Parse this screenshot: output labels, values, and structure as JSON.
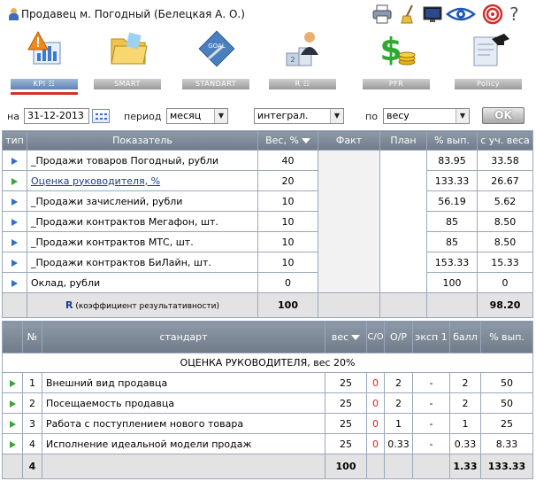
{
  "header": {
    "title": "Продавец м. Погодный  (Белецкая А. О.)",
    "help_glyph": "?"
  },
  "nav": [
    {
      "label": "KPI ☷",
      "icon": "kpi-chart-warning-icon",
      "active": true
    },
    {
      "label": "SMART",
      "icon": "folder-icon",
      "active": false
    },
    {
      "label": "STANDART",
      "icon": "goal-badge-icon",
      "active": false
    },
    {
      "label": "R ☷",
      "icon": "podium-person-icon",
      "active": false
    },
    {
      "label": "PFR",
      "icon": "dollar-coins-icon",
      "active": false
    },
    {
      "label": "Policy",
      "icon": "diploma-icon",
      "active": false
    }
  ],
  "filters": {
    "date_label": "на",
    "date_value": "31-12-2013",
    "period_label": "период",
    "period_value": "месяц",
    "mode_value": "интеграл.",
    "by_label": "по",
    "by_value": "весу",
    "ok_label": "OK"
  },
  "kpi_table": {
    "headers": [
      "тип",
      "Показатель",
      "Вес, %",
      "Факт",
      "План",
      "% вып.",
      "с уч. веса"
    ],
    "rows": [
      {
        "type": "blue",
        "name": "_Продажи товаров Погодный, рубли",
        "weight": "40",
        "pct": "83.95",
        "weighted": "33.58",
        "link": false
      },
      {
        "type": "green",
        "name": "Оценка руководителя, %",
        "weight": "20",
        "pct": "133.33",
        "weighted": "26.67",
        "link": true
      },
      {
        "type": "blue",
        "name": "_Продажи зачислений, рубли",
        "weight": "10",
        "pct": "56.19",
        "weighted": "5.62",
        "link": false
      },
      {
        "type": "blue",
        "name": "_Продажи контрактов Мегафон, шт.",
        "weight": "10",
        "pct": "85",
        "weighted": "8.50",
        "link": false
      },
      {
        "type": "blue",
        "name": "_Продажи контрактов МТС, шт.",
        "weight": "10",
        "pct": "85",
        "weighted": "8.50",
        "link": false
      },
      {
        "type": "blue",
        "name": "_Продажи контрактов БиЛайн, шт.",
        "weight": "10",
        "pct": "153.33",
        "weighted": "15.33",
        "link": false
      },
      {
        "type": "blue",
        "name": "Оклад, рубли",
        "weight": "0",
        "pct": "100",
        "weighted": "0",
        "link": false
      }
    ],
    "total": {
      "label_bold": "R",
      "label_rest": " (коэффициент результативности)",
      "weight": "100",
      "weighted": "98.20"
    }
  },
  "std_table": {
    "headers": [
      "",
      "№",
      "стандарт",
      "вес",
      "С/О",
      "О/Р",
      "эксп 1",
      "балл",
      "% вып."
    ],
    "section_title": "ОЦЕНКА РУКОВОДИТЕЛЯ, вес 20%",
    "rows": [
      {
        "n": "1",
        "name": "Внешний вид продавца",
        "weight": "25",
        "co": "0",
        "or": "2",
        "exp": "-",
        "score": "2",
        "pct": "50"
      },
      {
        "n": "2",
        "name": "Посещаемость продавца",
        "weight": "25",
        "co": "0",
        "or": "2",
        "exp": "-",
        "score": "2",
        "pct": "50"
      },
      {
        "n": "3",
        "name": "Работа с поступлением нового товара",
        "weight": "25",
        "co": "0",
        "or": "1",
        "exp": "-",
        "score": "1",
        "pct": "25"
      },
      {
        "n": "4",
        "name": "Исполнение идеальной модели продаж",
        "weight": "25",
        "co": "0",
        "or": "0.33",
        "exp": "-",
        "score": "0.33",
        "pct": "8.33"
      }
    ],
    "total": {
      "n": "4",
      "weight": "100",
      "score": "1.33",
      "pct": "133.33"
    }
  },
  "colors": {
    "header_bg": "#7b8796",
    "border": "#9aa8bd",
    "active_bar": "#d0312d",
    "tri_blue": "#2f6fc9",
    "tri_green": "#3aa33a",
    "zero_red": "#e02020"
  }
}
